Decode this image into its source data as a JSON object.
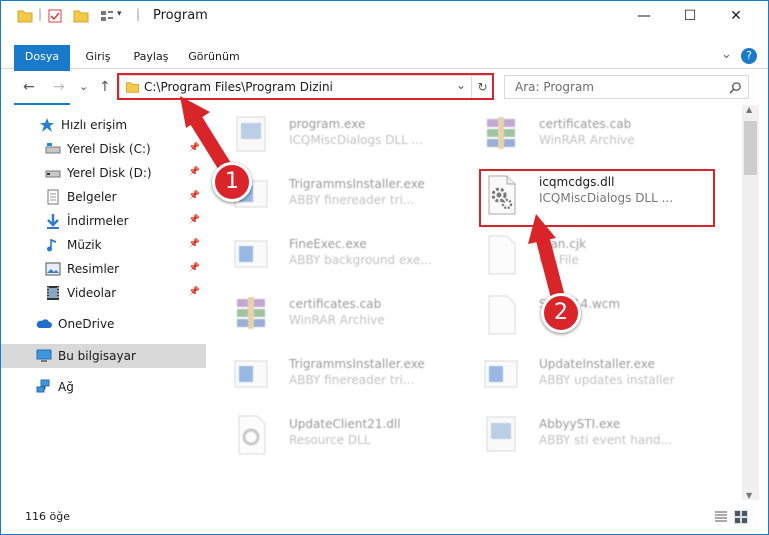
{
  "window": {
    "title": "Program",
    "minimize": "—",
    "maximize": "☐",
    "close": "✕"
  },
  "ribbon": {
    "tabs": [
      "Dosya",
      "Giriş",
      "Paylaş",
      "Görünüm"
    ],
    "collapse": "⌄",
    "help": "?"
  },
  "address": {
    "path": "C:\\Program Files\\Program Dizini",
    "back": "←",
    "forward": "→",
    "recent": "⌄",
    "up": "↑",
    "dropdown": "⌄",
    "refresh": "↻"
  },
  "search": {
    "placeholder": "Ara: Program"
  },
  "nav": {
    "quick_access": "Hızlı erişim",
    "items": [
      {
        "label": "Yerel Disk (C:)",
        "icon": "drive-icon"
      },
      {
        "label": "Yerel Disk (D:)",
        "icon": "drive-icon"
      },
      {
        "label": "Belgeler",
        "icon": "documents-icon"
      },
      {
        "label": "İndirmeler",
        "icon": "downloads-icon"
      },
      {
        "label": "Müzik",
        "icon": "music-icon"
      },
      {
        "label": "Resimler",
        "icon": "pictures-icon"
      },
      {
        "label": "Videolar",
        "icon": "videos-icon"
      }
    ],
    "onedrive": "OneDrive",
    "this_pc": "Bu bilgisayar",
    "network": "Ağ"
  },
  "files": {
    "left": [
      {
        "name": "program.exe",
        "desc": "ICQMiscDialogs DLL ..."
      },
      {
        "name": "TrigrammsInstaller.exe",
        "desc": "ABBY finereader tri..."
      },
      {
        "name": "FineExec.exe",
        "desc": "ABBY background exe..."
      },
      {
        "name": "certificates.cab",
        "desc": "WinRAR Archive"
      },
      {
        "name": "TrigrammsInstaller.exe",
        "desc": "ABBY finereader tri..."
      },
      {
        "name": "UpdateClient21.dll",
        "desc": "Resource DLL"
      }
    ],
    "right": [
      {
        "name": "certificates.cab",
        "desc": "WinRAR Archive"
      },
      {
        "name": "icqmcdgs.dll",
        "desc": "ICQMiscDialogs DLL ..."
      },
      {
        "name": "...an.cjk",
        "desc": "C...File"
      },
      {
        "name": "Sn...P14.wcm",
        "desc": ""
      },
      {
        "name": "UpdateInstaller.exe",
        "desc": "ABBY updates installer"
      },
      {
        "name": "AbbyySTI.exe",
        "desc": "ABBY sti event hand..."
      }
    ]
  },
  "status": {
    "count": "116 öğe"
  },
  "annotations": {
    "step1": "1",
    "step2": "2"
  },
  "colors": {
    "accent": "#1979ca",
    "annotation": "#d9252a"
  }
}
